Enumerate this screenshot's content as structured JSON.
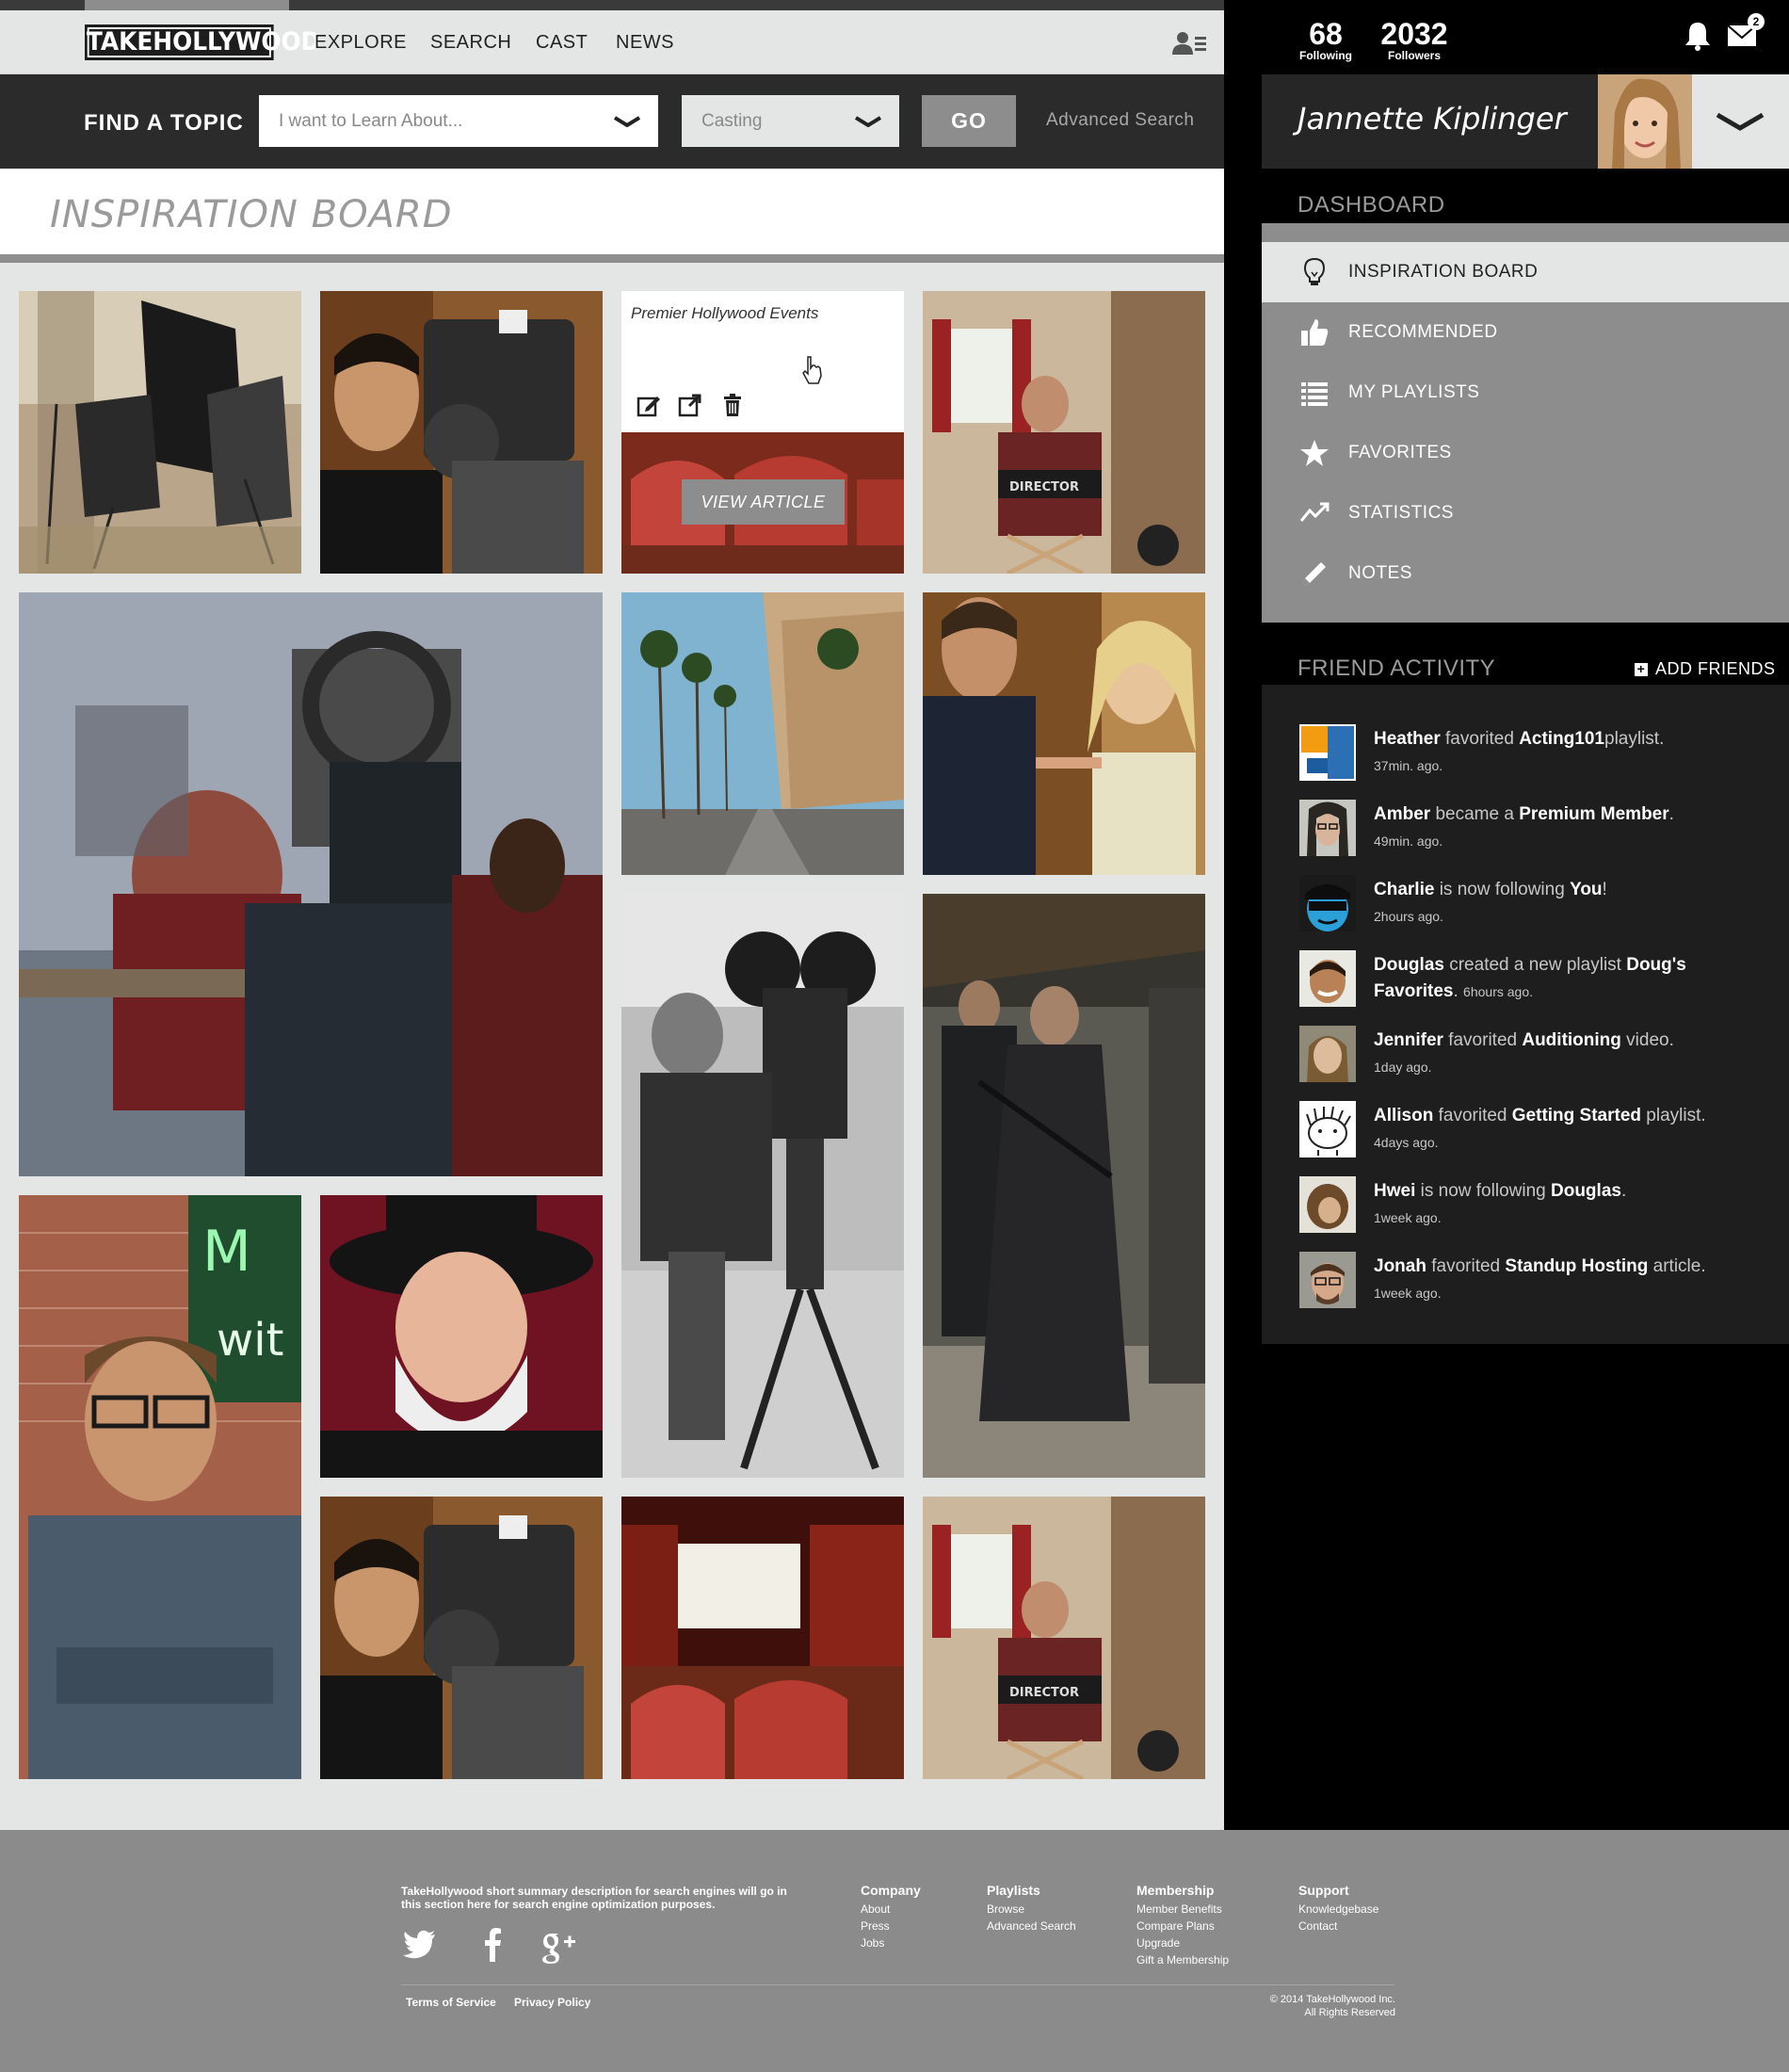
{
  "topnav": {
    "logo": "TAKEHOLLYWOOD",
    "links": [
      "EXPLORE",
      "SEARCH",
      "CAST",
      "NEWS"
    ]
  },
  "findbar": {
    "label": "FIND A TOPIC",
    "topic_placeholder": "I want to Learn About...",
    "category_value": "Casting",
    "go_label": "GO",
    "advanced_label": "Advanced Search"
  },
  "page": {
    "title": "INSPIRATION BOARD"
  },
  "card": {
    "title": "Premier Hollywood Events",
    "view_article_label": "VIEW ARTICLE"
  },
  "stats": {
    "following_count": "68",
    "following_label": "Following",
    "followers_count": "2032",
    "followers_label": "Followers",
    "mail_badge": "2"
  },
  "user": {
    "name": "Jannette Kiplinger"
  },
  "dashboard": {
    "title": "DASHBOARD",
    "items": [
      {
        "label": "INSPIRATION BOARD",
        "icon": "lightbulb-icon",
        "active": true
      },
      {
        "label": "RECOMMENDED",
        "icon": "thumbs-up-icon"
      },
      {
        "label": "MY PLAYLISTS",
        "icon": "list-icon"
      },
      {
        "label": "FAVORITES",
        "icon": "star-icon"
      },
      {
        "label": "STATISTICS",
        "icon": "trend-icon"
      },
      {
        "label": "NOTES",
        "icon": "pencil-icon"
      }
    ]
  },
  "friend_activity": {
    "title": "FRIEND ACTIVITY",
    "add_label": "ADD FRIENDS",
    "items": [
      {
        "name": "Heather",
        "action": "favorited",
        "target": "Acting101",
        "suffix": "playlist.",
        "time": "37min. ago."
      },
      {
        "name": "Amber",
        "action": "became a",
        "target": "Premium Member",
        "suffix": ".",
        "time": "49min. ago."
      },
      {
        "name": "Charlie",
        "action": "is now following",
        "target": "You",
        "suffix": "!",
        "time": "2hours ago."
      },
      {
        "name": "Douglas",
        "action": "created a new playlist",
        "target": "Doug's Favorites",
        "suffix": ".",
        "time": "6hours ago."
      },
      {
        "name": "Jennifer",
        "action": "favorited",
        "target": "Auditioning",
        "suffix": "video.",
        "time": "1day ago."
      },
      {
        "name": "Allison",
        "action": "favorited",
        "target": "Getting Started",
        "suffix": "playlist.",
        "time": "4days ago."
      },
      {
        "name": "Hwei",
        "action": "is now following",
        "target": "Douglas",
        "suffix": ".",
        "time": "1week ago."
      },
      {
        "name": "Jonah",
        "action": "favorited",
        "target": "Standup Hosting",
        "suffix": "article.",
        "time": "1week ago."
      }
    ]
  },
  "footer": {
    "description": "TakeHollywood short summary description for  search engines will go in this section here for search engine optimization purposes.",
    "columns": [
      {
        "heading": "Company",
        "links": [
          "About",
          "Press",
          "Jobs"
        ]
      },
      {
        "heading": "Playlists",
        "links": [
          "Browse",
          "Advanced Search"
        ]
      },
      {
        "heading": "Membership",
        "links": [
          "Member Benefits",
          "Compare Plans",
          "Upgrade",
          "Gift a Membership"
        ]
      },
      {
        "heading": "Support",
        "links": [
          "Knowledgebase",
          "Contact"
        ]
      }
    ],
    "terms": "Terms of Service",
    "privacy": "Privacy Policy",
    "copyright_line1": "© 2014 TakeHollywood Inc.",
    "copyright_line2": "All Rights Reserved",
    "social_icons": [
      "twitter-icon",
      "facebook-icon",
      "google-plus-icon"
    ]
  }
}
